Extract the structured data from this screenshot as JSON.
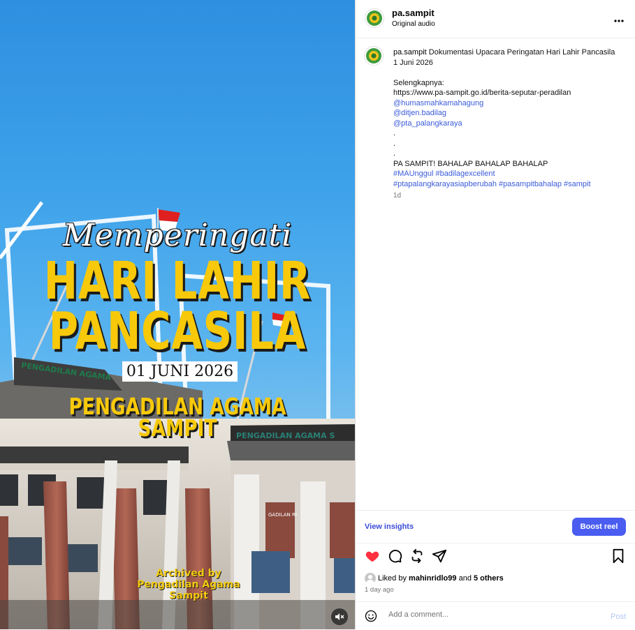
{
  "media": {
    "title_script": "Memperingati",
    "title_line1": "HARI LAHIR",
    "title_line2": "PANCASILA",
    "date": "01 JUNI 2026",
    "org_line1": "PENGADILAN AGAMA",
    "org_line2": "SAMPIT",
    "building_sign": "PENGADILAN AGAMA SAMPIT",
    "watermark_line1": "Archived by",
    "watermark_line2": "Pengadilan Agama",
    "watermark_line3": "Sampit",
    "mute_icon": "speaker-muted-icon"
  },
  "header": {
    "username": "pa.sampit",
    "audio": "Original audio",
    "more_icon": "more-horizontal-icon"
  },
  "caption": {
    "username": "pa.sampit",
    "text_line1": "Dokumentasi Upacara Peringatan Hari Lahir Pancasila",
    "text_line2": "1 Juni 2026",
    "more_label": "Selengkapnya:",
    "url": "https://www.pa-sampit.go.id/berita-seputar-peradilan",
    "mentions": [
      "@humasmahkamahagung",
      "@ditjen.badilag",
      "@pta_palangkaraya"
    ],
    "dots": [
      ".",
      ".",
      "."
    ],
    "slogan": "PA SAMPIT! BAHALAP BAHALAP BAHALAP",
    "hashtags_line1": "#MAUnggul #badilagexcellent",
    "hashtags_line2": "#ptapalangkarayasiapberubah #pasampitbahalap #sampit",
    "time": "1d"
  },
  "insights": {
    "view_label": "View insights",
    "boost_label": "Boost reel"
  },
  "actions": {
    "like_icon": "heart-icon",
    "comment_icon": "comment-icon",
    "repost_icon": "repost-icon",
    "share_icon": "send-icon",
    "save_icon": "bookmark-icon"
  },
  "likes": {
    "prefix": "Liked by",
    "user": "mahinridlo99",
    "and": "and",
    "others": "5 others"
  },
  "post_time": "1 day ago",
  "comment": {
    "placeholder": "Add a comment...",
    "post_label": "Post",
    "emoji_icon": "emoji-icon"
  },
  "colors": {
    "accent": "#4a5df0",
    "link": "#3a5bd9",
    "like_red": "#ff3040",
    "title_yellow": "#f7c90a"
  }
}
